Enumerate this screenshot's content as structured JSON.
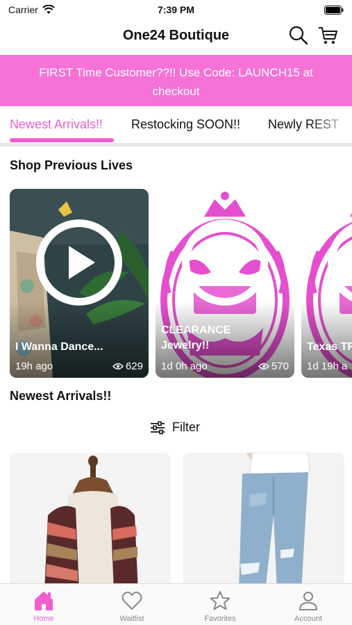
{
  "status_bar": {
    "carrier": "Carrier",
    "time": "7:39 PM"
  },
  "header": {
    "title": "One24 Boutique",
    "search_icon": "search-icon",
    "cart_icon": "cart-icon"
  },
  "promo": {
    "text": "FIRST Time Customer??!! Use Code: LAUNCH15 at checkout",
    "color": "#f672d6"
  },
  "tabs": [
    {
      "label": "Newest Arrivals!!",
      "active": true
    },
    {
      "label": "Restocking SOON!!",
      "active": false
    },
    {
      "label": "Newly REST",
      "active": false
    }
  ],
  "lives": {
    "heading": "Shop Previous Lives",
    "items": [
      {
        "title": "I Wanna Dance...",
        "time": "19h ago",
        "views": "629"
      },
      {
        "title": "CLEARANCE Jewelry!!",
        "time": "1d 0h ago",
        "views": "570"
      },
      {
        "title": "Texas TR",
        "time": "1d 19h a",
        "views": ""
      }
    ]
  },
  "arrivals": {
    "heading": "Newest Arrivals!!",
    "filter_label": "Filter"
  },
  "tab_bar": [
    {
      "label": "Home",
      "icon": "home-icon",
      "active": true
    },
    {
      "label": "Waitlist",
      "icon": "heart-icon",
      "active": false
    },
    {
      "label": "Favorites",
      "icon": "star-icon",
      "active": false
    },
    {
      "label": "Account",
      "icon": "user-icon",
      "active": false
    }
  ],
  "colors": {
    "accent": "#ef5fce",
    "banner": "#f672d6"
  }
}
